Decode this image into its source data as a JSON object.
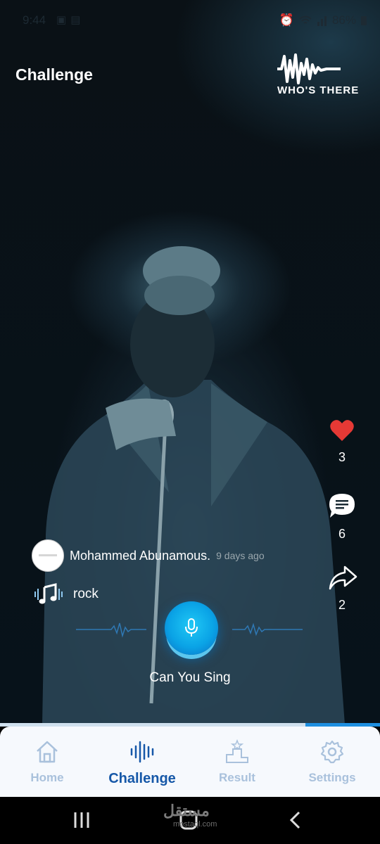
{
  "status_bar": {
    "time": "9:44",
    "battery": "86%",
    "icons": [
      "image-icon",
      "gmail-icon",
      "alarm-icon",
      "wifi-icon",
      "signal-icon",
      "battery-icon"
    ]
  },
  "header": {
    "title": "Challenge",
    "logo_text": "WHO'S THERE"
  },
  "actions": {
    "likes": "3",
    "comments": "6",
    "shares": "2",
    "like_color": "#e53935"
  },
  "post": {
    "username": "Mohammed Abunamous.",
    "time_ago": "9 days ago",
    "genre": "rock",
    "mic_caption": "Can You Sing"
  },
  "progress": {
    "fraction": 0.2
  },
  "nav": {
    "items": [
      {
        "label": "Home",
        "icon": "home-icon"
      },
      {
        "label": "Challenge",
        "icon": "soundwave-icon"
      },
      {
        "label": "Result",
        "icon": "podium-icon"
      },
      {
        "label": "Settings",
        "icon": "gear-icon"
      }
    ],
    "active": "Challenge",
    "active_color": "#1658a8",
    "inactive_color": "#a9c1dc"
  },
  "watermark": {
    "text": "مستقل",
    "sub": "mostaql.com"
  }
}
